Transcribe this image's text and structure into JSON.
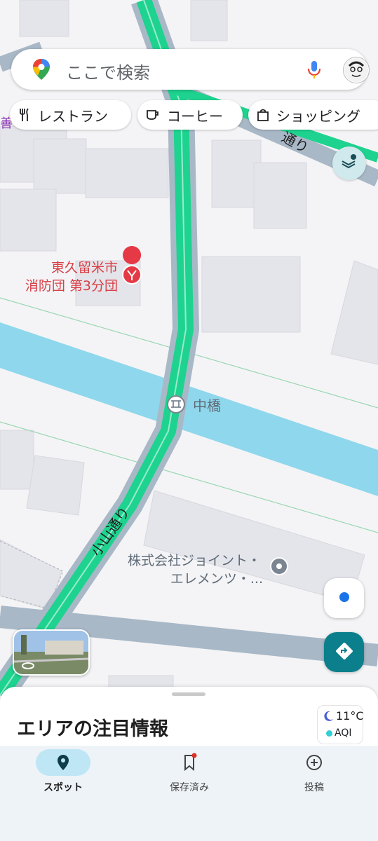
{
  "search": {
    "placeholder": "ここで検索"
  },
  "chips": [
    {
      "label": "レストラン",
      "icon": "fork-knife-icon"
    },
    {
      "label": "コーヒー",
      "icon": "coffee-cup-icon"
    },
    {
      "label": "ショッピング",
      "icon": "shopping-bag-icon"
    }
  ],
  "map": {
    "edge_text": "善",
    "poi_fire": {
      "line1": "東久留米市",
      "line2": "消防団 第3分団"
    },
    "poi_bridge": "中橋",
    "poi_company": {
      "line1": "株式会社ジョイント・",
      "line2": "エレメンツ・..."
    },
    "road_label": "小山通り",
    "road_label_top": "通り"
  },
  "sheet": {
    "title": "エリアの注目情報"
  },
  "weather": {
    "temp": "11°C",
    "aqi": "AQI"
  },
  "nav": [
    {
      "label": "スポット",
      "icon": "location-pin-icon",
      "active": true
    },
    {
      "label": "保存済み",
      "icon": "bookmark-icon",
      "active": false
    },
    {
      "label": "投稿",
      "icon": "add-circle-icon",
      "active": false
    }
  ],
  "colors": {
    "road_green": "#1ed38f",
    "road_gray": "#a9b8c7",
    "water": "#8fd7ec",
    "building": "#e4e5ea",
    "fire_poi": "#e53946",
    "accent": "#0b7f8b"
  }
}
